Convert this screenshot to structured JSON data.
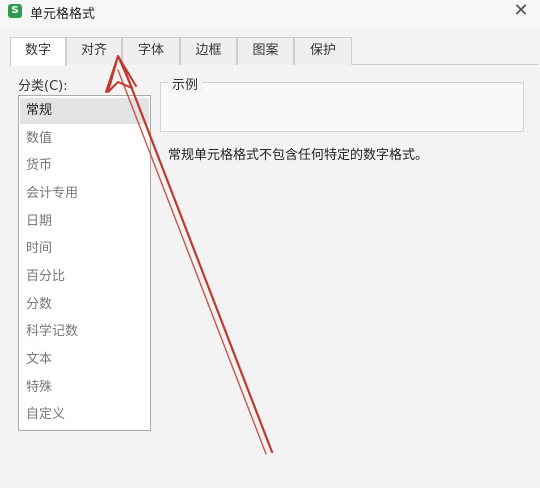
{
  "window": {
    "title": "单元格格式",
    "close_symbol": "✕",
    "app_icon_letter": "S"
  },
  "tabs": [
    {
      "label": "数字",
      "active": true
    },
    {
      "label": "对齐",
      "active": false
    },
    {
      "label": "字体",
      "active": false
    },
    {
      "label": "边框",
      "active": false
    },
    {
      "label": "图案",
      "active": false
    },
    {
      "label": "保护",
      "active": false
    }
  ],
  "category": {
    "label": "分类(C):",
    "items": [
      {
        "label": "常规",
        "selected": true
      },
      {
        "label": "数值",
        "selected": false
      },
      {
        "label": "货币",
        "selected": false
      },
      {
        "label": "会计专用",
        "selected": false
      },
      {
        "label": "日期",
        "selected": false
      },
      {
        "label": "时间",
        "selected": false
      },
      {
        "label": "百分比",
        "selected": false
      },
      {
        "label": "分数",
        "selected": false
      },
      {
        "label": "科学记数",
        "selected": false
      },
      {
        "label": "文本",
        "selected": false
      },
      {
        "label": "特殊",
        "selected": false
      },
      {
        "label": "自定义",
        "selected": false
      }
    ]
  },
  "sample": {
    "label": "示例"
  },
  "description": "常规单元格格式不包含任何特定的数字格式。",
  "annotation": {
    "arrow_color": "#c0392b"
  }
}
